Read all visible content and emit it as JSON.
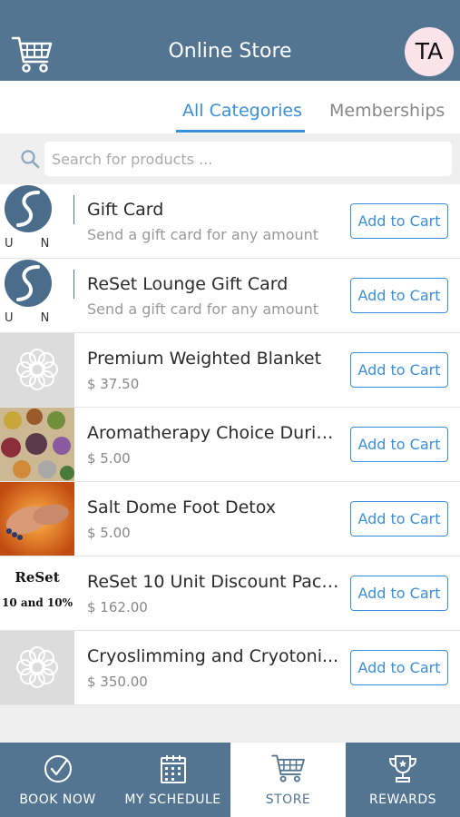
{
  "header": {
    "title": "Online Store",
    "avatar_initials": "TA",
    "logo_icon": "shopping-cart-icon"
  },
  "tabs": [
    {
      "label": "All Categories",
      "active": true
    },
    {
      "label": "Memberships",
      "active": false
    }
  ],
  "search": {
    "placeholder": "Search for products ...",
    "value": ""
  },
  "products": [
    {
      "name": "Gift Card",
      "subtitle": "Send a gift card for any amount",
      "thumb_letters": "U N",
      "button": "Add to Cart"
    },
    {
      "name": "ReSet Lounge Gift Card",
      "subtitle": "Send a gift card for any amount",
      "thumb_letters": "U N",
      "button": "Add to Cart"
    },
    {
      "name": "Premium Weighted Blanket",
      "price": "$ 37.50",
      "button": "Add to Cart"
    },
    {
      "name": "Aromatherapy Choice Durin...",
      "price": "$ 5.00",
      "button": "Add to Cart"
    },
    {
      "name": "Salt Dome Foot Detox",
      "price": "$ 5.00",
      "button": "Add to Cart"
    },
    {
      "name": "ReSet 10 Unit Discount Pack...",
      "price": "$ 162.00",
      "thumb_line1": "ReSet",
      "thumb_line2": "10 and 10%",
      "button": "Add to Cart"
    },
    {
      "name": "Cryoslimming and Cryotoni...",
      "price": "$ 350.00",
      "button": "Add to Cart"
    }
  ],
  "tabbar": [
    {
      "label": "BOOK NOW",
      "icon": "check-circle-icon",
      "active": false
    },
    {
      "label": "MY SCHEDULE",
      "icon": "calendar-icon",
      "active": false
    },
    {
      "label": "STORE",
      "icon": "shopping-cart-icon",
      "active": true
    },
    {
      "label": "REWARDS",
      "icon": "trophy-icon",
      "active": false
    }
  ],
  "colors": {
    "header_bg": "#547591",
    "accent": "#3a8fd9",
    "avatar_bg": "#fbe3ea"
  }
}
